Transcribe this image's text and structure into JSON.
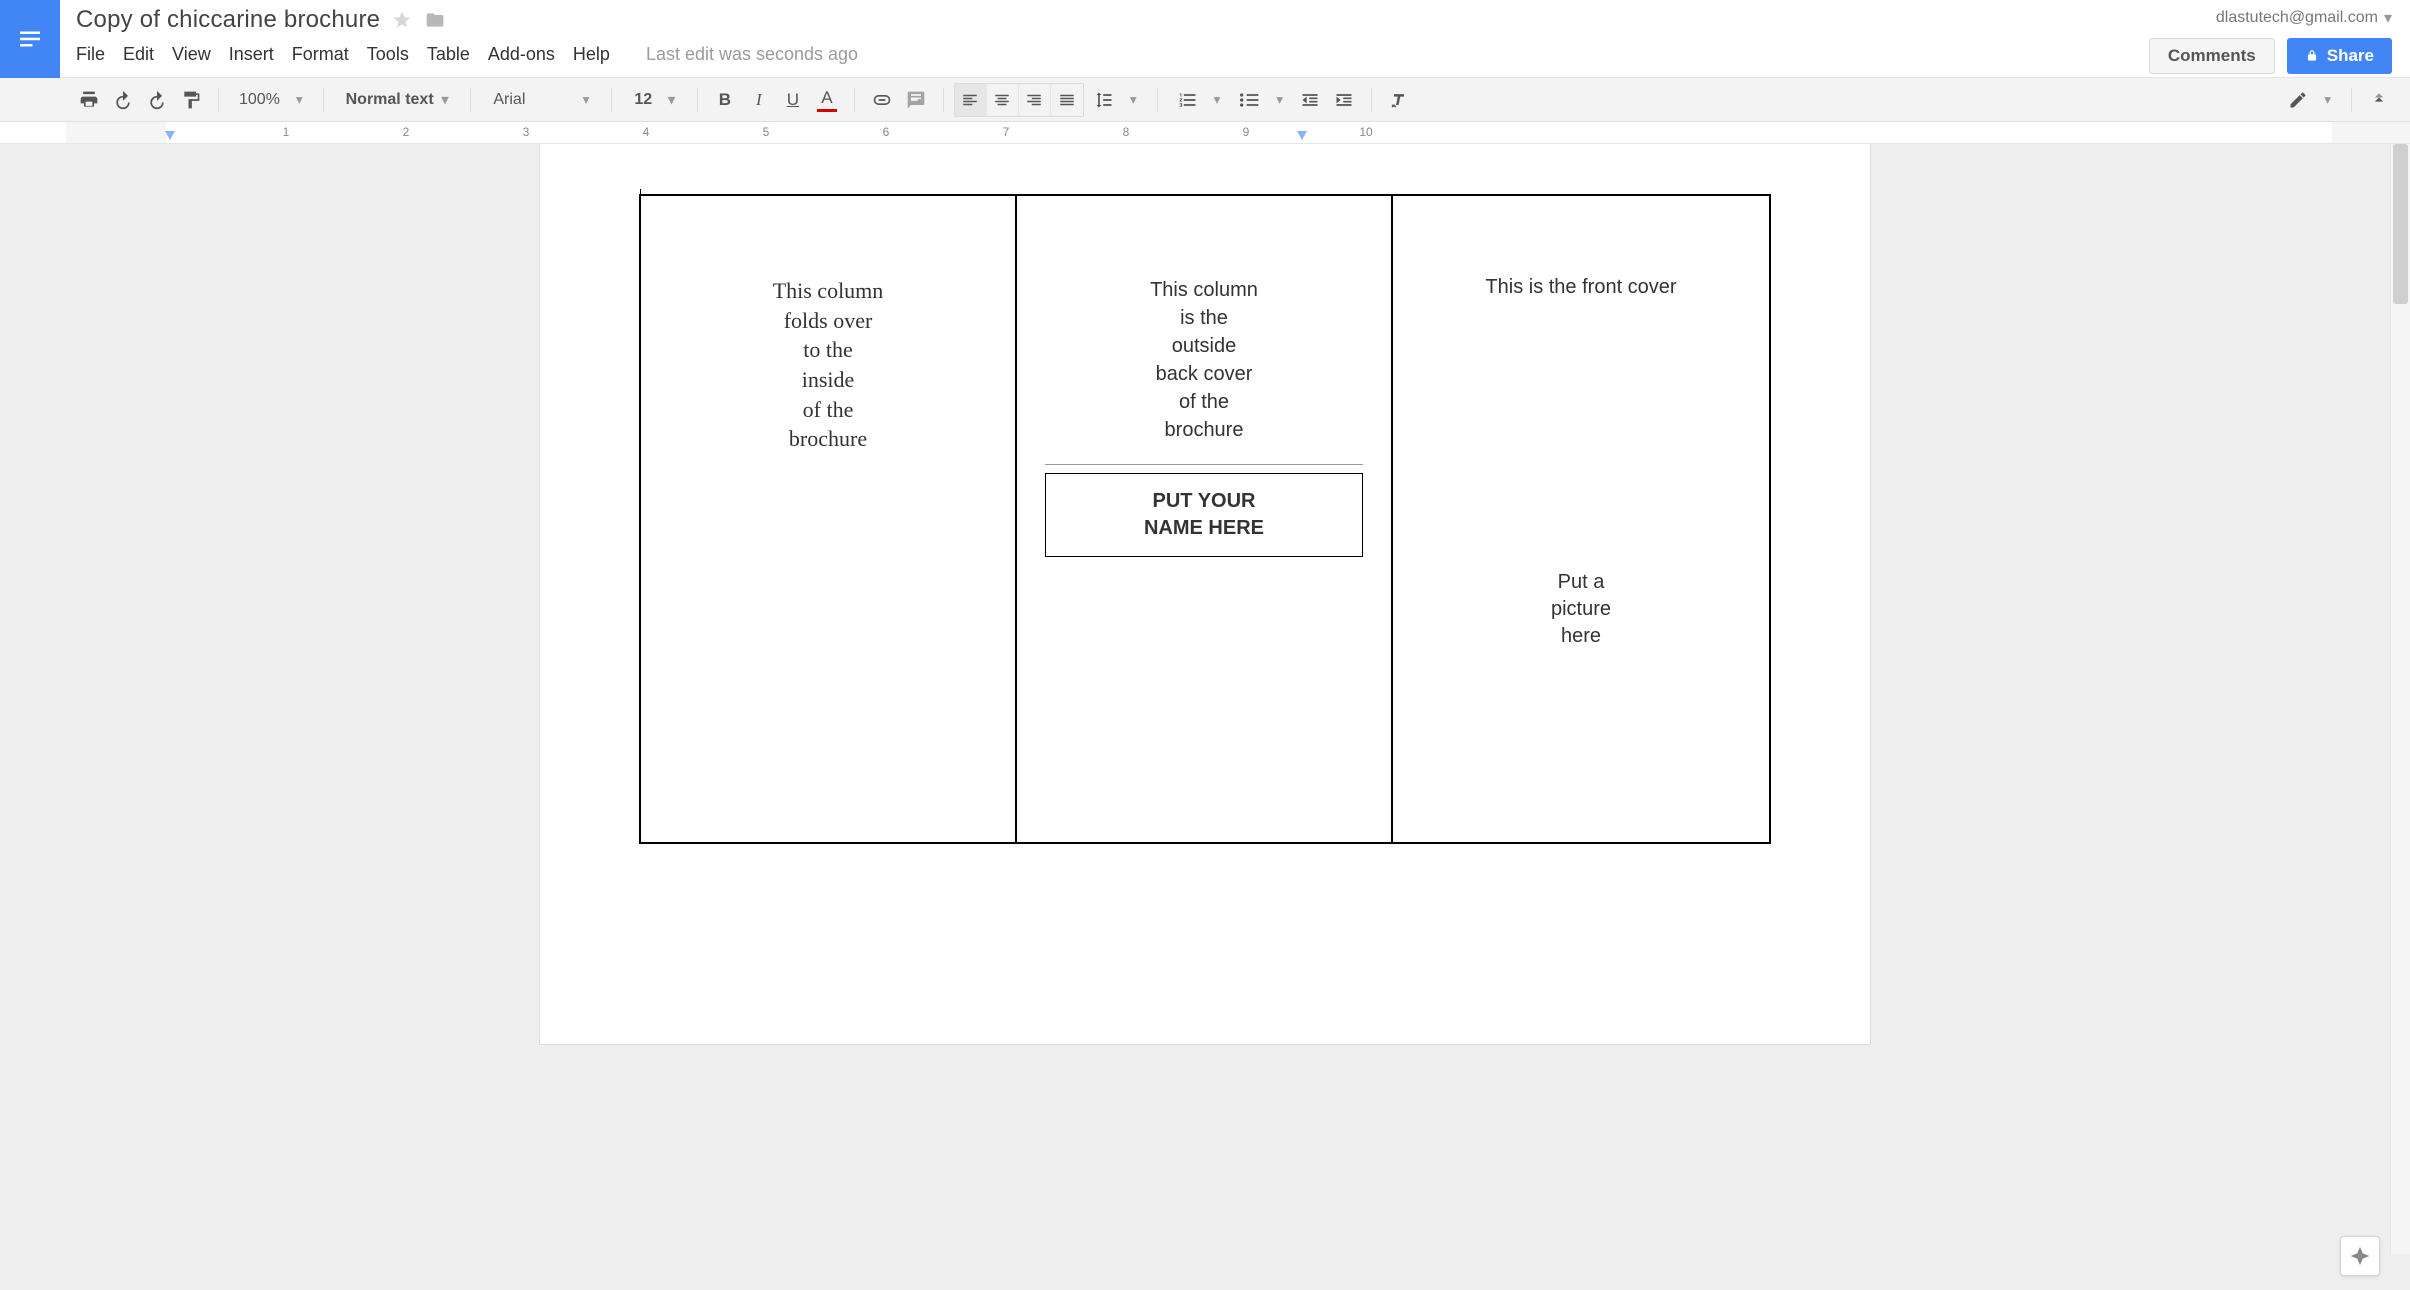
{
  "header": {
    "doc_title": "Copy of chiccarine brochure",
    "account_email": "dlastutech@gmail.com",
    "comments_label": "Comments",
    "share_label": "Share",
    "last_edit": "Last edit was seconds ago"
  },
  "menubar": {
    "items": [
      "File",
      "Edit",
      "View",
      "Insert",
      "Format",
      "Tools",
      "Table",
      "Add-ons",
      "Help"
    ]
  },
  "toolbar": {
    "zoom": "100%",
    "style": "Normal text",
    "font": "Arial",
    "font_size": "12"
  },
  "ruler": {
    "numbers": [
      "1",
      "2",
      "3",
      "4",
      "5",
      "6",
      "7",
      "8",
      "9",
      "10"
    ]
  },
  "document": {
    "col1_text": "This column\nfolds over\nto the\ninside\nof the\nbrochure",
    "col2_text": "This column\nis the\noutside\nback cover\nof the\nbrochure",
    "col2_namebox": "PUT YOUR\nNAME HERE",
    "col3_top": "This is the front cover",
    "col3_pic": "Put a\npicture\nhere"
  }
}
